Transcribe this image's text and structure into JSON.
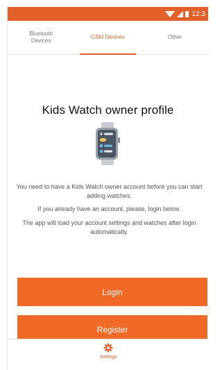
{
  "status_bar": {
    "time": "12:3",
    "icons": [
      "wifi-icon",
      "signal-icon",
      "battery-icon"
    ]
  },
  "tabs": [
    {
      "label": "Bluetooth\nDevices",
      "active": false
    },
    {
      "label": "GSM Devices",
      "active": true
    },
    {
      "label": "Other",
      "active": false
    }
  ],
  "main": {
    "title": "Kids Watch owner profile",
    "illustration": "smartwatch-icon",
    "paragraph1": "You need to have a Kids Watch owner account before you can start adding watches.",
    "paragraph2": "If you already have an account, please, login below.",
    "paragraph3": "The app will load your account settings and watches after login automatically.",
    "login_label": "Login",
    "register_label": "Register"
  },
  "bottom_nav": {
    "settings_label": "Settings",
    "settings_icon": "gear-icon"
  },
  "colors": {
    "accent": "#e2612a",
    "button": "#ee6a26"
  }
}
